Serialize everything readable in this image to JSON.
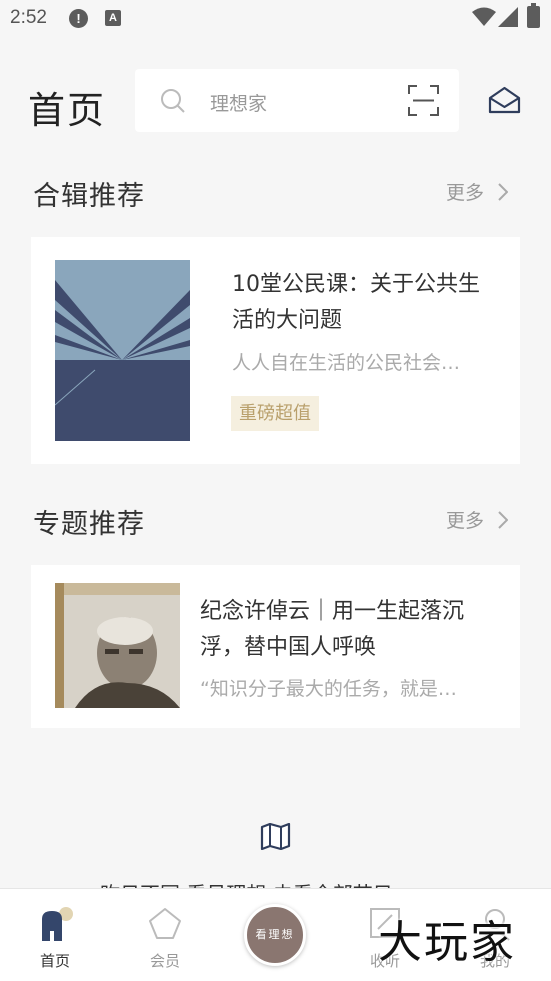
{
  "status_bar": {
    "time": "2:52",
    "alert_glyph": "!",
    "keyboard_glyph": "A",
    "icons": [
      "alert-icon",
      "keyboard-icon",
      "wifi-icon",
      "signal-icon",
      "battery-icon"
    ]
  },
  "header": {
    "title": "首页",
    "search_placeholder": "理想家",
    "icons": [
      "search-icon",
      "scan-icon",
      "mail-icon"
    ]
  },
  "collection_section": {
    "title": "合辑推荐",
    "more_label": "更多",
    "card": {
      "title": "10堂公民课：关于公共生活的大问题",
      "subtitle": "人人自在生活的公民社会…",
      "tag": "重磅超值"
    }
  },
  "topic_section": {
    "title": "专题推荐",
    "more_label": "更多",
    "card": {
      "title": "纪念许倬云｜用一生起落沉浮，替中国人呼唤",
      "subtitle": "“知识分子最大的任务，就是…"
    }
  },
  "footer_link": "昨日不同 看见理想 去看全部节目",
  "tabbar": {
    "tabs": [
      {
        "label": "首页",
        "icon": "home-icon",
        "active": true
      },
      {
        "label": "会员",
        "icon": "member-diamond-icon",
        "active": false
      },
      {
        "label": "收听",
        "icon": "listen-icon",
        "active": false
      },
      {
        "label": "我的",
        "icon": "profile-icon",
        "active": false
      }
    ],
    "center_button_label": "看理想"
  },
  "watermark": "大玩家",
  "colors": {
    "background": "#f6f6f6",
    "card": "#ffffff",
    "tag_bg": "#f5efdf",
    "tag_text": "#b9a06c",
    "accent_navy": "#3b4a6b",
    "center_button": "#8a7670"
  }
}
